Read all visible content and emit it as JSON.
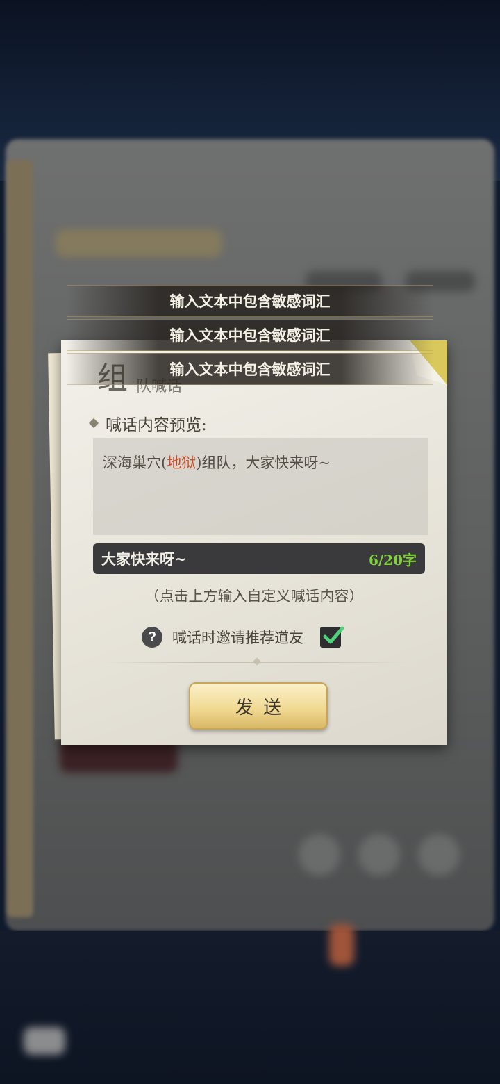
{
  "toasts": [
    "输入文本中包含敏感词汇",
    "输入文本中包含敏感词汇",
    "输入文本中包含敏感词汇"
  ],
  "dialog": {
    "title_big": "组",
    "title_small": "队喊话",
    "preview_label": "喊话内容预览:",
    "preview": {
      "before": "深海巢穴(",
      "highlight": "地狱",
      "after": ")组队，大家快来呀~"
    },
    "input_value": "大家快来呀~",
    "char_count": "6/20字",
    "hint": "（点击上方输入自定义喊话内容）",
    "invite_label": "喊话时邀请推荐道友",
    "invite_checked": true,
    "send_label": "发送"
  },
  "colors": {
    "highlight": "#c9502c",
    "count": "#7fd23a",
    "button_gold": "#efd78f"
  }
}
